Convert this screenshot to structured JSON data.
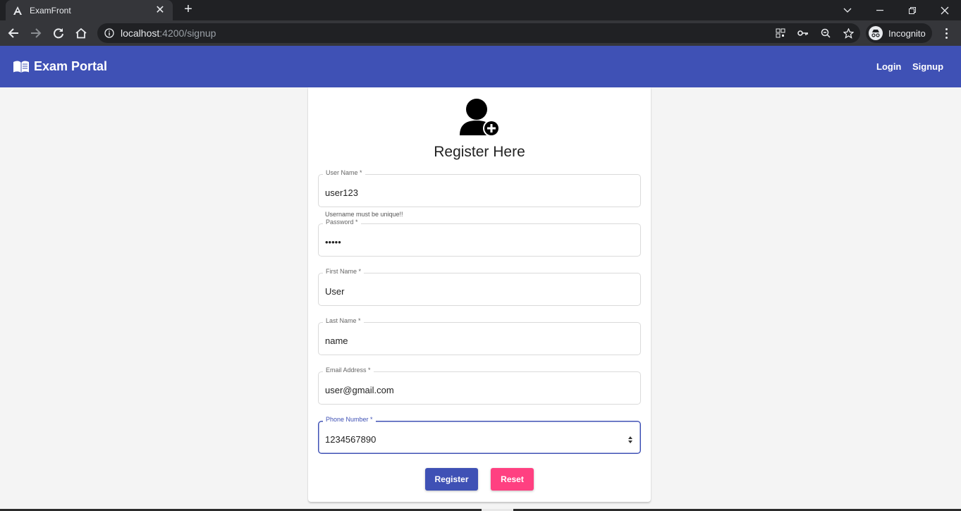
{
  "browser": {
    "tab_title": "ExamFront",
    "url_host": "localhost",
    "url_rest": ":4200/signup",
    "profile_label": "Incognito"
  },
  "navbar": {
    "brand": "Exam Portal",
    "links": [
      "Login",
      "Signup"
    ],
    "color": "#3f51b5"
  },
  "form": {
    "title": "Register Here",
    "fields": [
      {
        "label": "User Name *",
        "value": "user123",
        "hint": "Username must be unique!!"
      },
      {
        "label": "Password *",
        "value": "•••••"
      },
      {
        "label": "First Name *",
        "value": "User"
      },
      {
        "label": "Last Name *",
        "value": "name"
      },
      {
        "label": "Email Address *",
        "value": "user@gmail.com"
      },
      {
        "label": "Phone Number *",
        "value": "1234567890",
        "focused": true
      }
    ],
    "buttons": {
      "register": "Register",
      "reset": "Reset"
    },
    "colors": {
      "primary": "#3f51b5",
      "accent": "#ff4081"
    }
  },
  "icons": [
    "angular-icon",
    "back-icon",
    "forward-icon",
    "reload-icon",
    "home-icon",
    "info-icon",
    "qr-icon",
    "key-icon",
    "zoom-icon",
    "star-icon",
    "incognito-icon",
    "menu-icon",
    "book-icon",
    "add-user-icon",
    "spinner-arrows-icon"
  ]
}
